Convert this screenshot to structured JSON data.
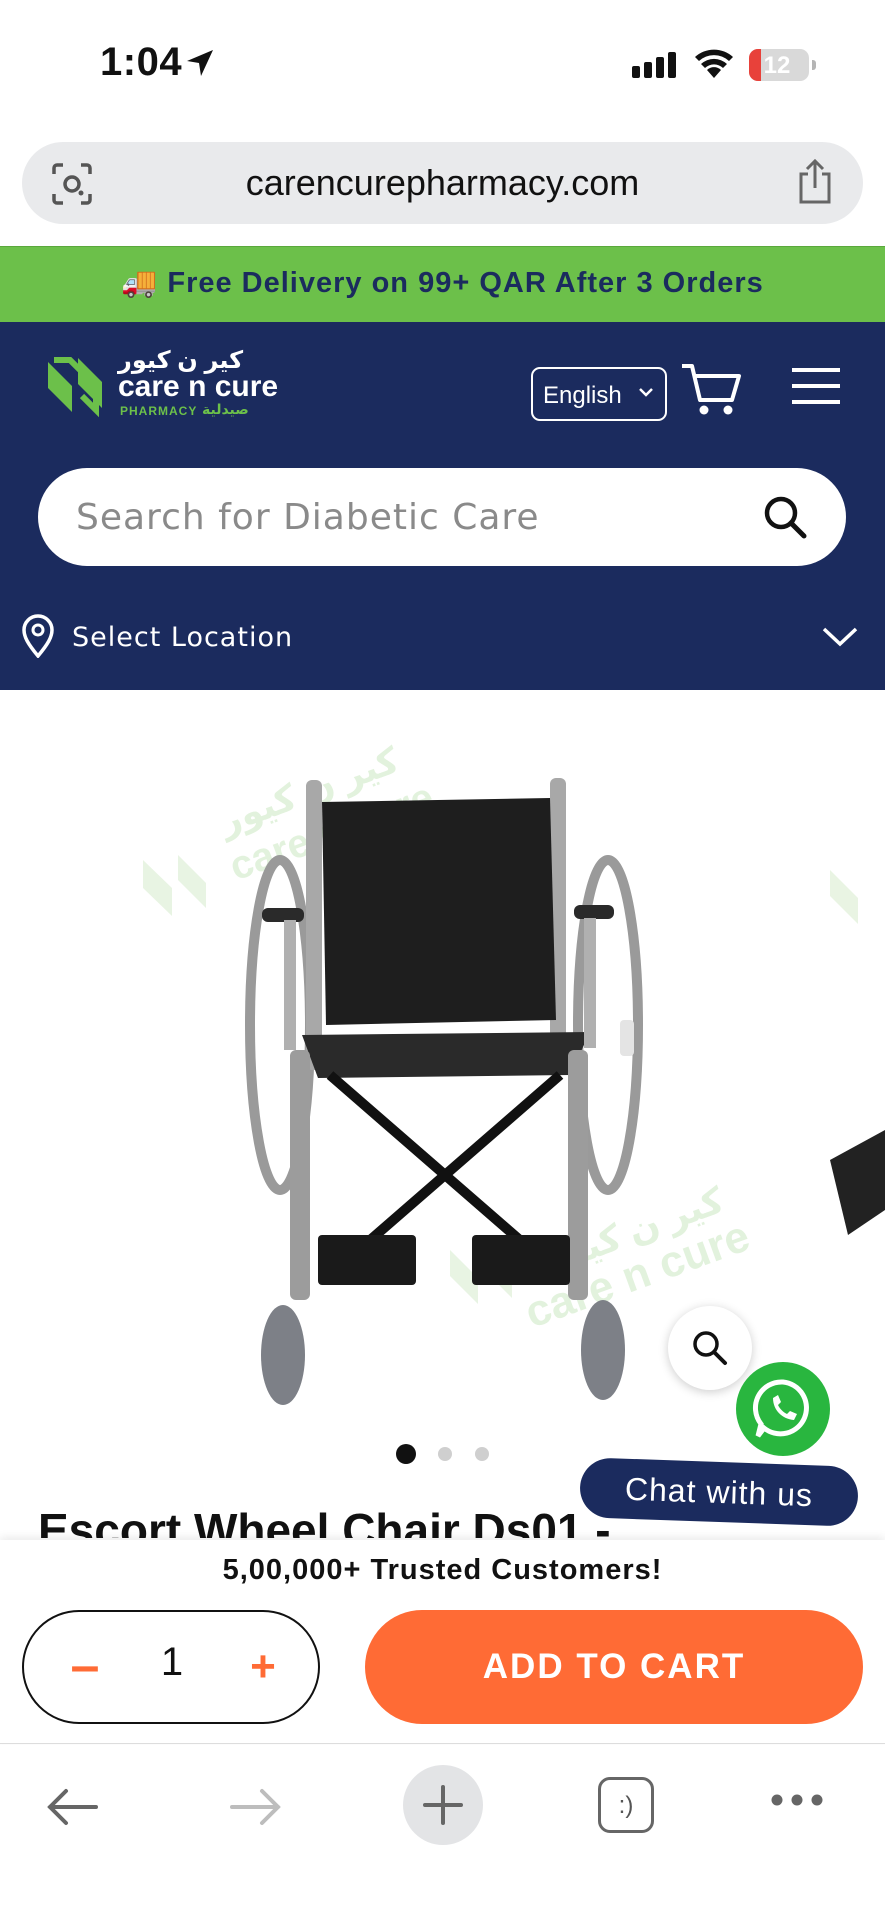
{
  "status_bar": {
    "time": "1:04",
    "battery": "12"
  },
  "browser": {
    "url": "carencurepharmacy.com"
  },
  "promo": {
    "text": "🚚 Free Delivery on 99+ QAR After 3 Orders"
  },
  "header": {
    "logo": {
      "arabic": "كير ن كيور",
      "brand": "care n cure",
      "sub": "PHARMACY",
      "sub_ar": "صيدلية"
    },
    "language": "English",
    "search_placeholder": "Search for Diabetic Care",
    "location_label": "Select Location"
  },
  "gallery": {
    "watermark_brand": "care n cure",
    "watermark_ar": "كير ن كيور",
    "dots": 3,
    "active_dot": 0
  },
  "chat": {
    "label": "Chat with us"
  },
  "product": {
    "title": "Escort Wheel Chair Ds01 -"
  },
  "sticky": {
    "trusted": "5,00,000+ Trusted Customers!",
    "qty_minus": "–",
    "qty_value": "1",
    "qty_plus": "+",
    "add_to_cart": "ADD TO CART"
  },
  "toolbar": {
    "tabs_glyph": ":)"
  },
  "colors": {
    "navy": "#1b2b5e",
    "green": "#6cc04a",
    "orange": "#ff6b35",
    "whatsapp": "#29b63f"
  }
}
